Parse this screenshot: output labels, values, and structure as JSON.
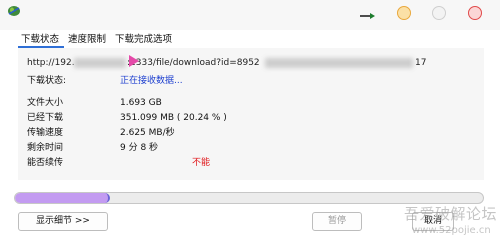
{
  "window": {
    "controls": [
      "minimize-button",
      "maximize-button",
      "close-button"
    ],
    "icons": {
      "app": "globe-icon",
      "tray": "arrow-icon"
    }
  },
  "tabs": [
    {
      "label": "下载状态",
      "active": true
    },
    {
      "label": "速度限制",
      "active": false
    },
    {
      "label": "下载完成选项",
      "active": false
    }
  ],
  "url": {
    "prefix": "http://192.",
    "middle": ":2333/file/download?id=8952",
    "suffix": "17"
  },
  "status": {
    "label": "下载状态:",
    "value": "正在接收数据..."
  },
  "info": {
    "rows": [
      {
        "label": "文件大小",
        "value": "1.693  GB"
      },
      {
        "label": "已经下载",
        "value": "351.099  MB  ( 20.24 % )"
      },
      {
        "label": "传输速度",
        "value": "2.625  MB/秒"
      },
      {
        "label": "剩余时间",
        "value": "9 分 8 秒"
      },
      {
        "label": "能否续传",
        "value": "不能"
      }
    ]
  },
  "progress": {
    "fraction": 0.2024
  },
  "buttons": {
    "details": "显示细节 >>",
    "pause": "暂停",
    "cancel": "取消"
  },
  "watermark": {
    "text": "吾爱破解论坛",
    "url": "www.52pojie.cn"
  },
  "colors": {
    "accent": "#2f6fd6",
    "status": "#1d3fcf",
    "warning": "#e0161a",
    "progress_fill": "#c39bf1"
  }
}
